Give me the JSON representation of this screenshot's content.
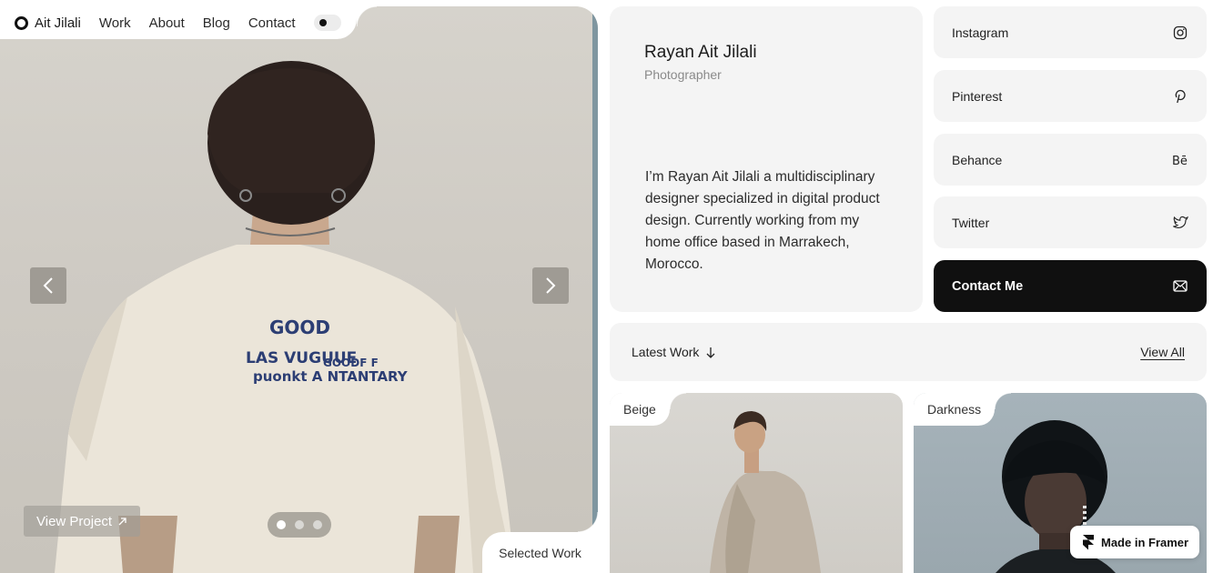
{
  "nav": {
    "brand": "Ait Jilali",
    "links": [
      "Work",
      "About",
      "Blog",
      "Contact"
    ]
  },
  "hero": {
    "view_project": "View Project",
    "selected_work": "Selected Work",
    "slides_total": 3,
    "slide_active": 1
  },
  "profile": {
    "name": "Rayan Ait Jilali",
    "role": "Photographer",
    "bio": "I’m Rayan Ait Jilali a multidisciplinary designer specialized in digital product design. Currently working from my home office based in Marrakech, Morocco."
  },
  "social": [
    {
      "label": "Instagram",
      "icon": "instagram-icon"
    },
    {
      "label": "Pinterest",
      "icon": "pinterest-icon"
    },
    {
      "label": "Behance",
      "icon": "behance-icon"
    },
    {
      "label": "Twitter",
      "icon": "twitter-icon"
    }
  ],
  "contact": {
    "label": "Contact Me",
    "icon": "mail-icon"
  },
  "latest": {
    "label": "Latest Work",
    "view_all": "View All"
  },
  "works": [
    {
      "tag": "Beige"
    },
    {
      "tag": "Darkness"
    }
  ],
  "badge": {
    "label": "Made in Framer"
  },
  "colors": {
    "card_bg": "#f4f4f4",
    "dark_button": "#101010",
    "hero_bg": "#d6d3cc",
    "dark_work_bg": "#a6b3ba"
  }
}
